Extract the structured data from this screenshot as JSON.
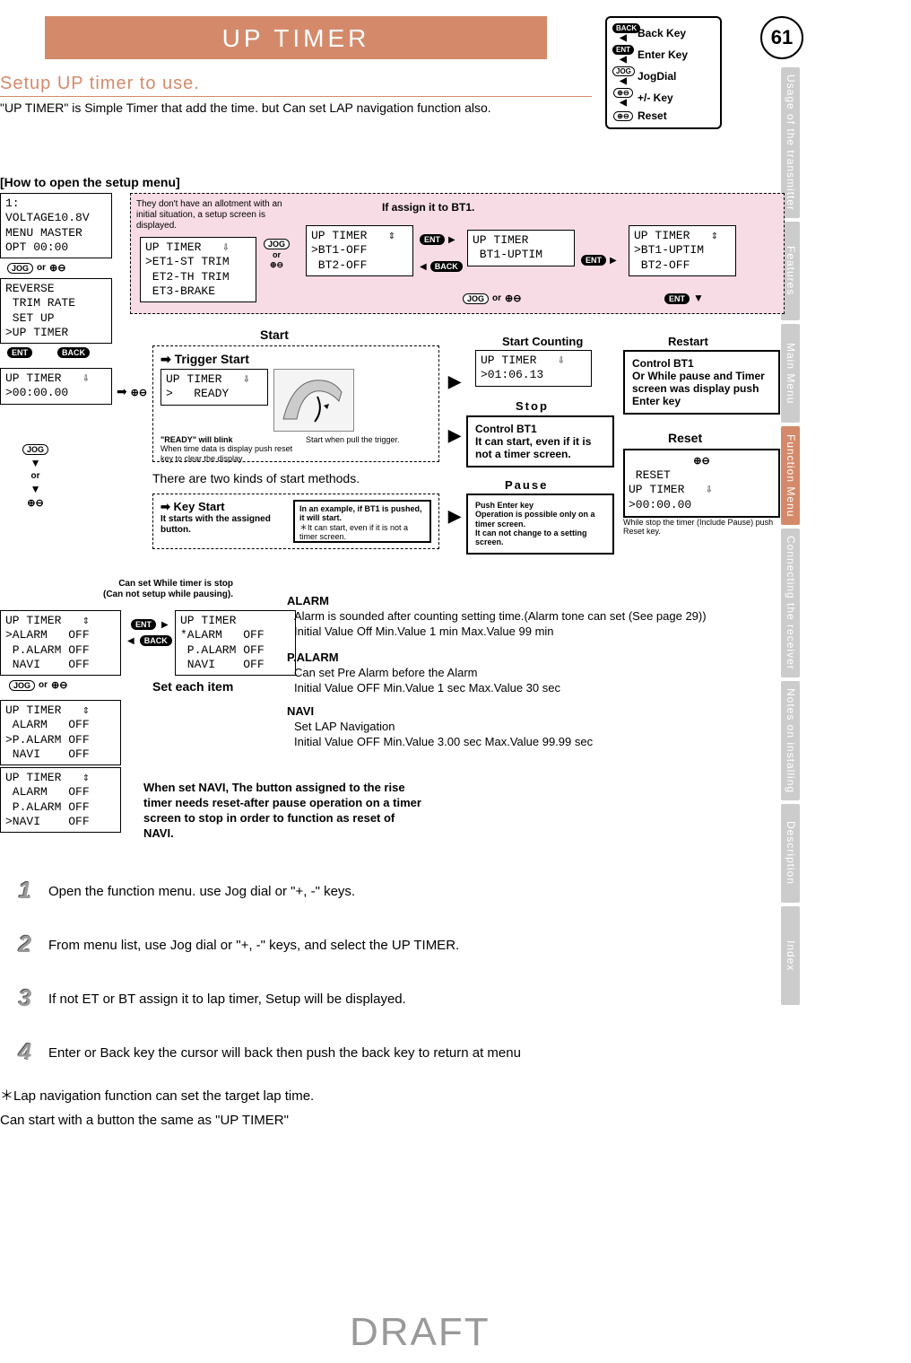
{
  "page": {
    "title": "UP TIMER",
    "number": "61",
    "subtitle": "Setup UP timer to use.",
    "intro": "\"UP TIMER\" is Simple Timer that add the time. but Can set LAP navigation function also.",
    "howto": "[How to open the setup menu]",
    "draft": "DRAFT"
  },
  "legend": {
    "back": "Back Key",
    "enter": "Enter Key",
    "jog": "JogDial",
    "plusminus": "+/- Key",
    "reset": "Reset"
  },
  "side_tabs": [
    "Usage of the transmitter",
    "Features",
    "Main Menu",
    "Function Menu",
    "Connecting the receiver",
    "Notes on installing",
    "Description",
    "Index"
  ],
  "flow": {
    "lcd_menu": "1:\nVOLTAGE10.8V\nMENU MASTER\nOPT 00:00",
    "lcd_list": "REVERSE\n TRIM RATE\n SET UP\n>UP TIMER",
    "lcd_timer_zero": "UP TIMER   ⇩\n>00:00.00",
    "pink_note": "They don't have an allotment with an initial situation, a setup screen is displayed.",
    "pink_heading": "If assign it to BT1.",
    "lcd_et": "UP TIMER   ⇩\n>ET1-ST TRIM\n ET2-TH TRIM\n ET3-BRAKE",
    "lcd_bt_sel": "UP TIMER   ⇕\n>BT1-OFF\n BT2-OFF",
    "lcd_bt_uptim": "UP TIMER\n BT1-UPTIM",
    "lcd_bt_uptim2": "UP TIMER   ⇕\n>BT1-UPTIM\n BT2-OFF",
    "start_label": "Start",
    "start_counting_label": "Start Counting",
    "restart_label": "Restart",
    "trigger_start": "Trigger Start",
    "lcd_ready": "UP TIMER   ⇩\n>   READY",
    "ready_blink": "\"READY\" will blink",
    "ready_note": "When time data is display push reset key to clear the display",
    "trigger_note": "Start when pull the trigger.",
    "two_kinds": "There are two kinds of start methods.",
    "key_start": "Key Start",
    "key_start_note": "It starts with the assigned button.",
    "key_start_box": "In an example, if BT1 is pushed, it will start.",
    "key_start_box2": "＊It can start, even if it is not a timer screen.",
    "lcd_counting": "UP TIMER   ⇩\n>01:06.13",
    "stop_label": "Stop",
    "stop_box": "Control BT1\nIt can start, even if it is not a timer screen.",
    "pause_label": "Pause",
    "pause_box": "Push Enter key\nOperation is possible only on a timer screen.\nIt can not change to a setting screen.",
    "restart_box": "Control BT1\nOr While pause and Timer screen was display push Enter key",
    "reset_label": "Reset",
    "reset_lcd": " RESET\nUP TIMER   ⇩\n>00:00.00",
    "reset_note": "While stop the timer (Include Pause) push Reset key.",
    "or": "or",
    "jog": "JOG",
    "ent": "ENT",
    "back": "BACK"
  },
  "settings": {
    "note_top": "Can set While timer is stop\n(Can not setup while pausing).",
    "lcd_alarm_sel": "UP TIMER   ⇕\n>ALARM   OFF\n P.ALARM OFF\n NAVI    OFF",
    "lcd_alarm_star": "UP TIMER\n*ALARM   OFF\n P.ALARM OFF\n NAVI    OFF",
    "lcd_palarm_sel": "UP TIMER   ⇕\n ALARM   OFF\n>P.ALARM OFF\n NAVI    OFF",
    "lcd_navi_sel": "UP TIMER   ⇕\n ALARM   OFF\n P.ALARM OFF\n>NAVI    OFF",
    "set_each": "Set each item",
    "alarm_hd": "ALARM",
    "alarm_l1": "Alarm is sounded after counting setting time.(Alarm tone can set (See page 29))",
    "alarm_l2": "Initial Value Off Min.Value 1 min Max.Value 99 min",
    "palarm_hd": "P.ALARM",
    "palarm_l1": "Can set Pre Alarm before the Alarm",
    "palarm_l2": "Initial Value OFF Min.Value 1 sec Max.Value 30 sec",
    "navi_hd": "NAVI",
    "navi_l1": "Set LAP Navigation",
    "navi_l2": "Initial Value OFF Min.Value 3.00 sec Max.Value 99.99 sec",
    "navi_reset_note": "When set NAVI, The button assigned to the rise timer needs reset-after pause operation on a timer screen to stop in order to function as reset of NAVI."
  },
  "steps": [
    "Open the function menu. use Jog dial or \"+, -\" keys.",
    "From menu list, use Jog dial or \"+, -\" keys, and select the UP TIMER.",
    "If not ET or BT assign it to lap timer, Setup will be displayed.",
    "Enter or Back key the cursor will back then push the back key to return at menu"
  ],
  "footnotes": {
    "lap": "＊Lap navigation function can set the target lap time.",
    "start": "Can start with a button the same as  \"UP TIMER\""
  }
}
